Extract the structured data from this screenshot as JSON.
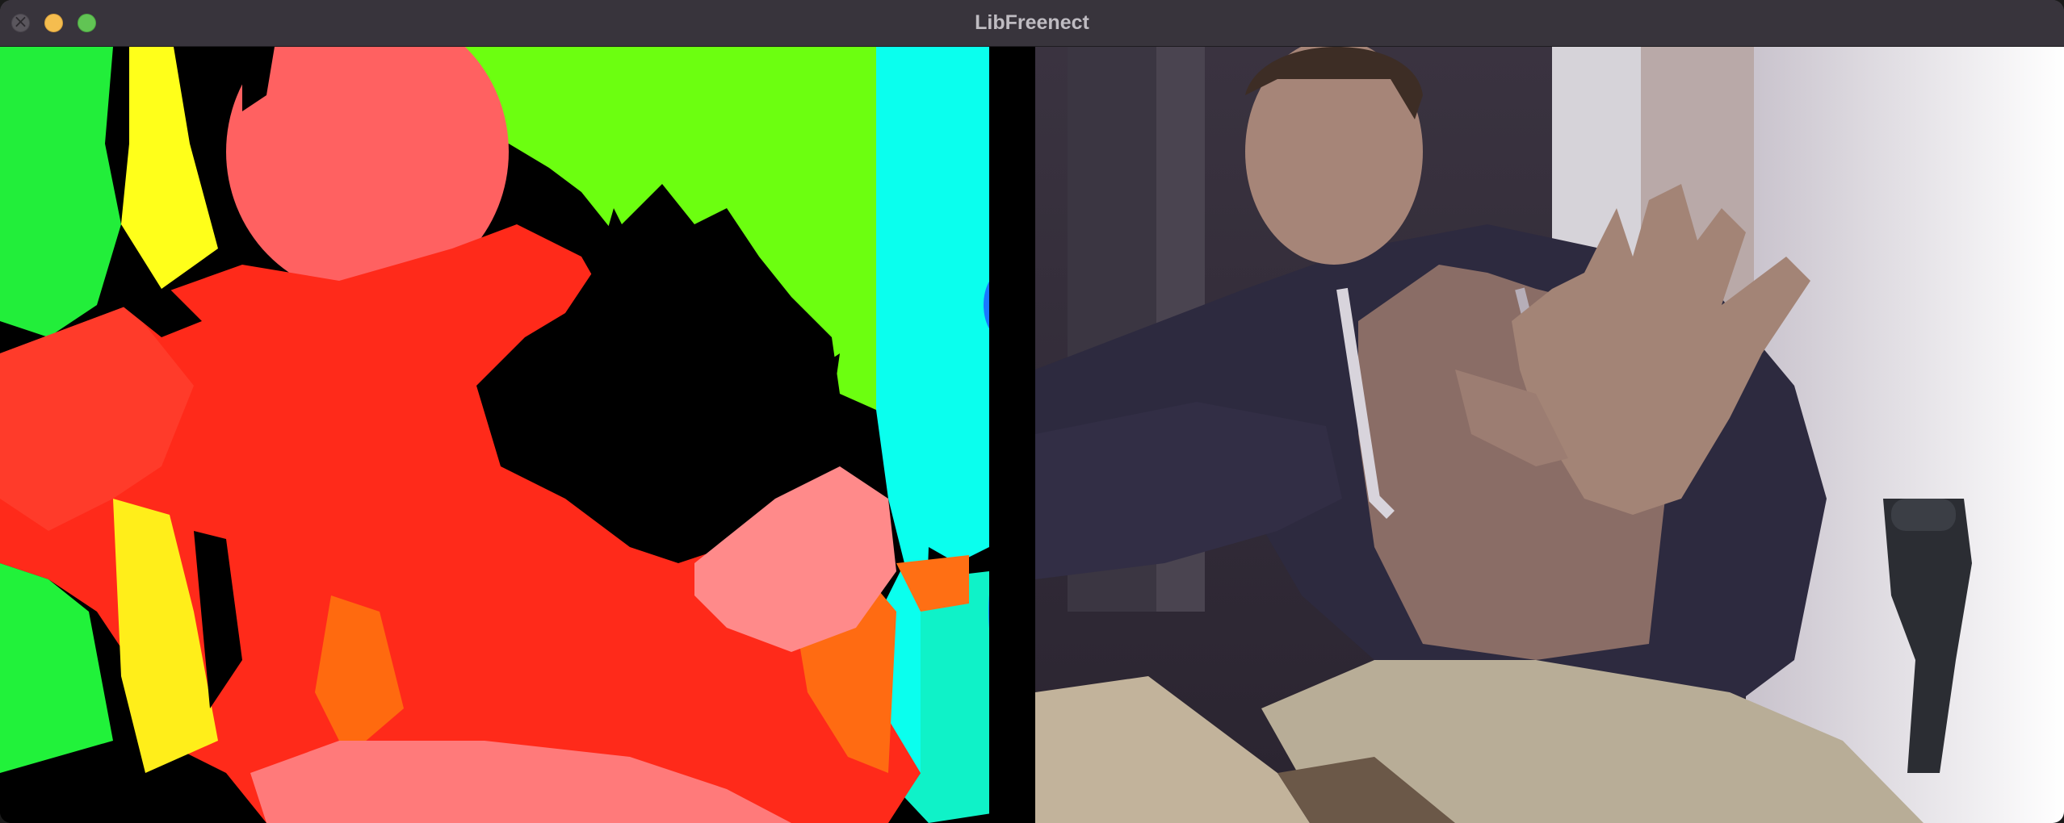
{
  "window": {
    "title": "LibFreenect"
  },
  "controls": {
    "close": "close-icon",
    "minimize": "minimize-icon",
    "maximize": "maximize-icon"
  },
  "panes": {
    "depth": "depth-view",
    "rgb": "rgb-camera-view"
  }
}
